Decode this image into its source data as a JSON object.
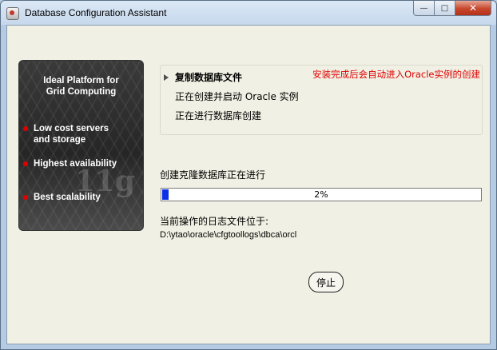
{
  "window": {
    "title": "Database Configuration Assistant",
    "icon": "dbca-app-icon"
  },
  "caption_buttons": {
    "minimize": "—",
    "maximize": "□",
    "close": "✕"
  },
  "promo": {
    "title_line1": "Ideal Platform for",
    "title_line2": "Grid Computing",
    "bullets": [
      {
        "line1": "Low cost servers",
        "line2": "and storage"
      },
      {
        "line1": "Highest availability",
        "line2": ""
      },
      {
        "line1": "Best scalability",
        "line2": ""
      }
    ],
    "watermark": "11g"
  },
  "steps": {
    "items": [
      {
        "label": "复制数据库文件",
        "current": true
      },
      {
        "label": "正在创建并启动 Oracle 实例",
        "current": false
      },
      {
        "label": "正在进行数据库创建",
        "current": false
      }
    ],
    "note": "安装完成后会自动进入Oracle实例的创建"
  },
  "progress": {
    "label": "创建克隆数据库正在进行",
    "value": 0.02,
    "text": "2%"
  },
  "log": {
    "label": "当前操作的日志文件位于:",
    "path": "D:\\ytao\\oracle\\cfgtoollogs\\dbca\\orcl"
  },
  "buttons": {
    "stop": "停止"
  },
  "colors": {
    "note": "#e00000",
    "progress_fill": "#0a2fe6",
    "panel_bg": "#f0f0e4"
  }
}
